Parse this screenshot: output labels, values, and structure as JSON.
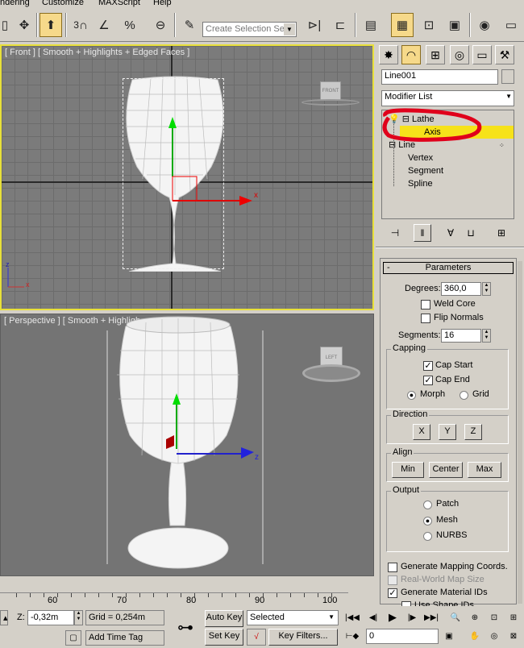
{
  "menu": {
    "items": [
      "ndering",
      "Customize",
      "MAXScript",
      "Help"
    ]
  },
  "toolbar": {
    "selection_set_placeholder": "Create Selection Set",
    "snap_count": "3",
    "percent_snap": "%"
  },
  "viewports": {
    "front": {
      "label": "[ Front ] [ Smooth + Highlights + Edged Faces ]",
      "cube_label": "FRONT",
      "axis_x": "x",
      "axis_z": "z"
    },
    "perspective": {
      "label": "[ Perspective ] [ Smooth + Highligh",
      "cube_label": "LEFT",
      "axis_z": "z"
    }
  },
  "command_panel": {
    "object_name": "Line001",
    "modifier_list": "Modifier List",
    "stack": [
      {
        "label": "Lathe",
        "indent": 0
      },
      {
        "label": "Axis",
        "indent": 2,
        "selected": true
      },
      {
        "label": "Line",
        "indent": 0
      },
      {
        "label": "Vertex",
        "indent": 1
      },
      {
        "label": "Segment",
        "indent": 1
      },
      {
        "label": "Spline",
        "indent": 1
      }
    ],
    "parameters": {
      "title": "Parameters",
      "degrees_label": "Degrees:",
      "degrees_value": "360,0",
      "weld_core": "Weld Core",
      "flip_normals": "Flip Normals",
      "segments_label": "Segments:",
      "segments_value": "16",
      "capping": {
        "title": "Capping",
        "cap_start": "Cap Start",
        "cap_end": "Cap End",
        "morph": "Morph",
        "grid": "Grid"
      },
      "direction": {
        "title": "Direction",
        "x": "X",
        "y": "Y",
        "z": "Z"
      },
      "align": {
        "title": "Align",
        "min": "Min",
        "center": "Center",
        "max": "Max"
      },
      "output": {
        "title": "Output",
        "patch": "Patch",
        "mesh": "Mesh",
        "nurbs": "NURBS"
      },
      "gen_mapping": "Generate Mapping Coords.",
      "real_world": "Real-World Map Size",
      "gen_material": "Generate Material IDs",
      "use_shape": "Use Shape IDs"
    }
  },
  "timeline": {
    "ticks": [
      "60",
      "70",
      "80",
      "90",
      "100"
    ]
  },
  "status": {
    "z_label": "Z:",
    "z_value": "-0,32m",
    "grid": "Grid = 0,254m",
    "add_time_tag": "Add Time Tag",
    "auto_key": "Auto Key",
    "set_key": "Set Key",
    "selected": "Selected",
    "key_filters": "Key Filters...",
    "frame": "0"
  },
  "colors": {
    "highlight": "#f6e21a",
    "annotation": "#e0001b",
    "active_viewport": "#e8e03a"
  }
}
